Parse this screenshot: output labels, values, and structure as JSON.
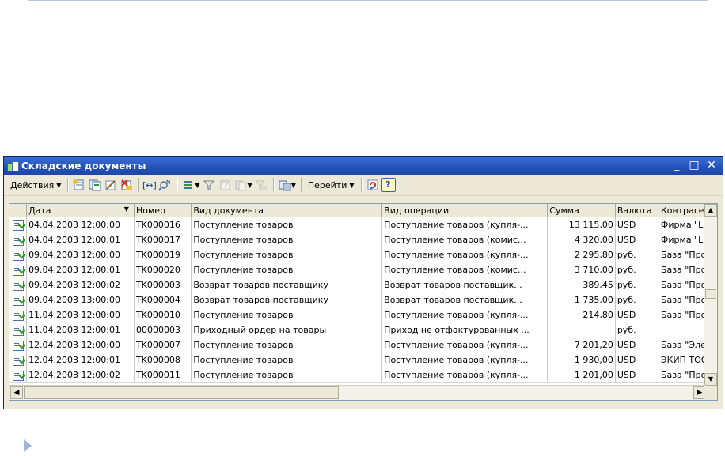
{
  "window": {
    "title": "Складские документы"
  },
  "toolbar": {
    "actions_label": "Действия",
    "goto_label": "Перейти",
    "help_label": "?"
  },
  "grid": {
    "columns": [
      "",
      "Дата",
      "Номер",
      "Вид документа",
      "Вид операции",
      "Сумма",
      "Валюта",
      "Контрагент"
    ],
    "rows": [
      [
        "04.04.2003 12:00:00",
        "TK000016",
        "Поступление товаров",
        "Поступление товаров (купля-...",
        "13 115,00",
        "USD",
        "Фирма \"LI"
      ],
      [
        "04.04.2003 12:00:01",
        "TK000017",
        "Поступление товаров",
        "Поступление товаров (комис...",
        "4 320,00",
        "USD",
        "Фирма \"LI"
      ],
      [
        "09.04.2003 12:00:00",
        "TK000019",
        "Поступление товаров",
        "Поступление товаров (купля-...",
        "2 295,80",
        "руб.",
        "База \"Про"
      ],
      [
        "09.04.2003 12:00:01",
        "TK000020",
        "Поступление товаров",
        "Поступление товаров (комис...",
        "3 710,00",
        "руб.",
        "База \"Про"
      ],
      [
        "09.04.2003 12:00:02",
        "TK000003",
        "Возврат товаров поставщику",
        "Возврат товаров поставщик...",
        "389,45",
        "руб.",
        "База \"Про"
      ],
      [
        "09.04.2003 13:00:00",
        "TK000004",
        "Возврат товаров поставщику",
        "Возврат товаров поставщик...",
        "1 735,00",
        "руб.",
        "База \"Про"
      ],
      [
        "11.04.2003 12:00:00",
        "TK000010",
        "Поступление товаров",
        "Поступление товаров (купля-...",
        "214,80",
        "USD",
        "База \"Про"
      ],
      [
        "11.04.2003 12:00:01",
        "00000003",
        "Приходный ордер на товары",
        "Приход не отфактурованных ...",
        "",
        "руб.",
        ""
      ],
      [
        "12.04.2003 12:00:00",
        "TK000007",
        "Поступление товаров",
        "Поступление товаров (купля-...",
        "7 201,20",
        "USD",
        "База \"Эле"
      ],
      [
        "12.04.2003 12:00:01",
        "TK000008",
        "Поступление товаров",
        "Поступление товаров (купля-...",
        "1 930,00",
        "USD",
        "ЭКИП ТОО"
      ],
      [
        "12.04.2003 12:00:02",
        "TK000011",
        "Поступление товаров",
        "Поступление товаров (купля-...",
        "1 201,00",
        "USD",
        "База \"Про"
      ]
    ]
  }
}
